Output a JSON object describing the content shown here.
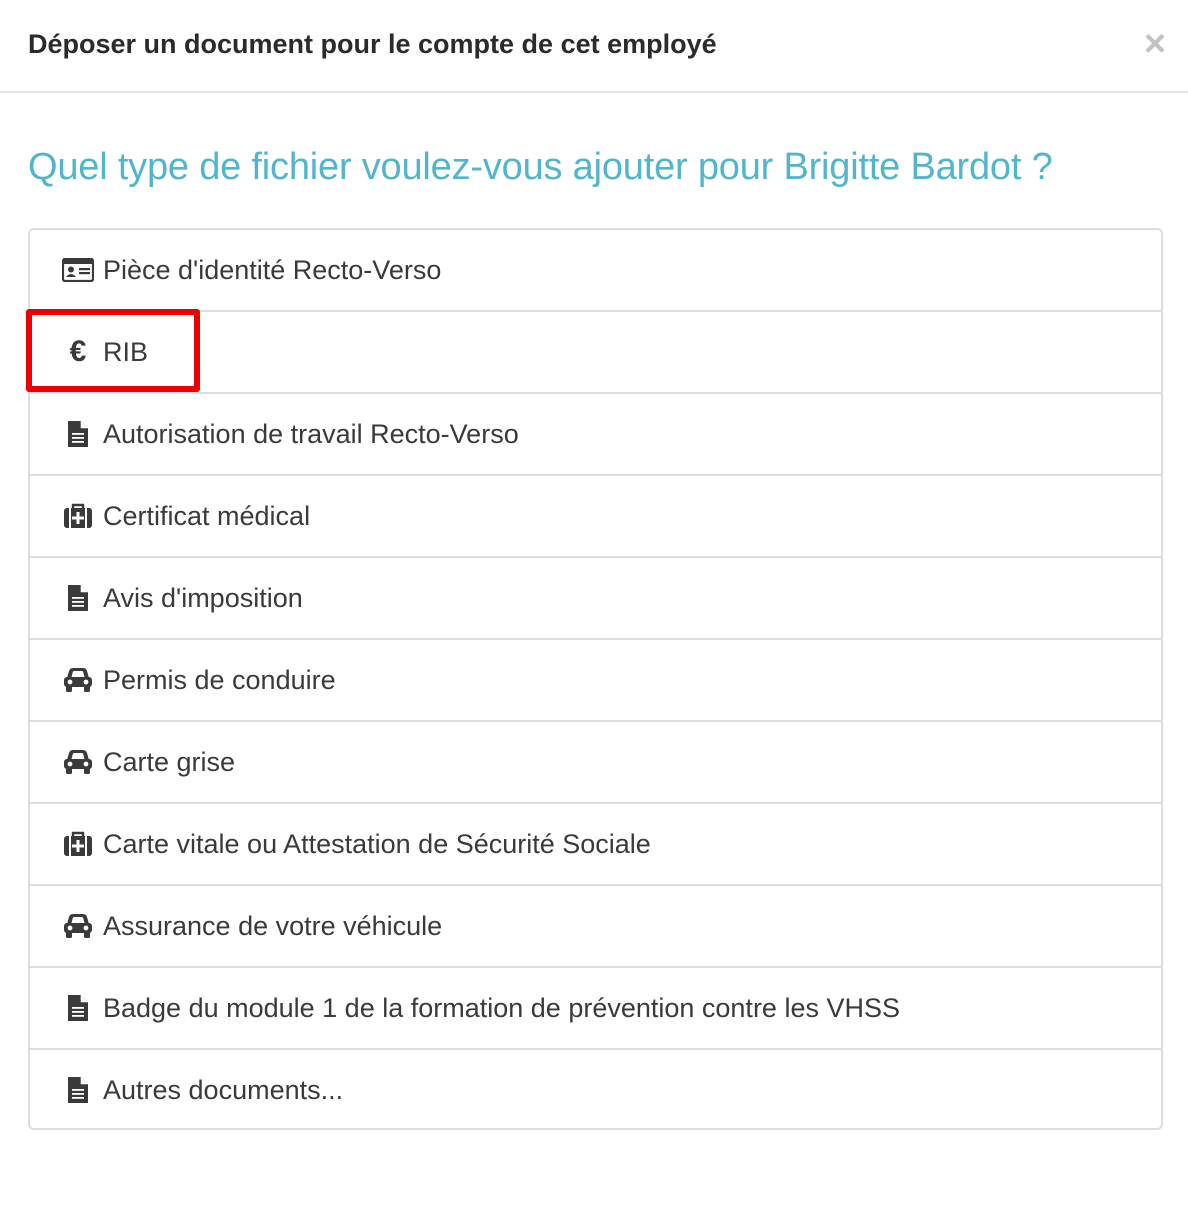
{
  "modal": {
    "title": "Déposer un document pour le compte de cet employé",
    "close_label": "×"
  },
  "question": "Quel type de fichier voulez-vous ajouter pour Brigitte Bardot ?",
  "accent_color": "#52b5cc",
  "highlight_color": "#ee0000",
  "documents": [
    {
      "label": "Pièce d'identité Recto-Verso",
      "icon": "id-card-icon"
    },
    {
      "label": "RIB",
      "icon": "euro-icon",
      "highlighted": true
    },
    {
      "label": "Autorisation de travail Recto-Verso",
      "icon": "file-text-icon"
    },
    {
      "label": "Certificat médical",
      "icon": "medkit-icon"
    },
    {
      "label": "Avis d'imposition",
      "icon": "file-text-icon"
    },
    {
      "label": "Permis de conduire",
      "icon": "car-icon"
    },
    {
      "label": "Carte grise",
      "icon": "car-icon"
    },
    {
      "label": "Carte vitale ou Attestation de Sécurité Sociale",
      "icon": "medkit-icon"
    },
    {
      "label": "Assurance de votre véhicule",
      "icon": "car-icon"
    },
    {
      "label": "Badge du module 1 de la formation de prévention contre les VHSS",
      "icon": "file-text-icon"
    },
    {
      "label": "Autres documents...",
      "icon": "file-text-icon"
    }
  ],
  "icons": {
    "euro_glyph": "€"
  }
}
